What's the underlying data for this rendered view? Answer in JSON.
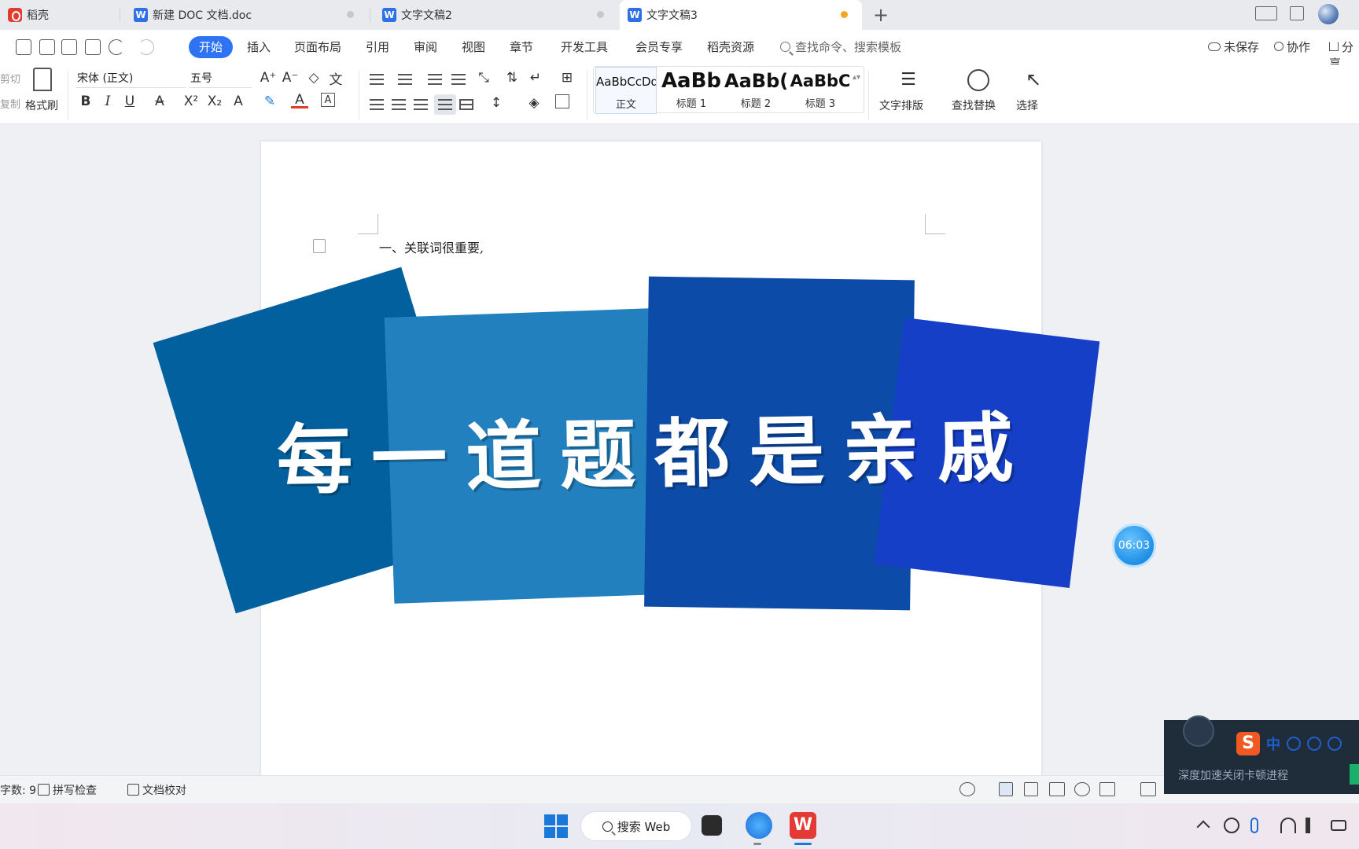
{
  "tabs": [
    {
      "label": "稻壳"
    },
    {
      "label": "新建 DOC 文档.doc"
    },
    {
      "label": "文字文稿2"
    },
    {
      "label": "文字文稿3"
    }
  ],
  "tab_icon_letter": "W",
  "menu": {
    "active": "开始",
    "items": [
      "插入",
      "页面布局",
      "引用",
      "审阅",
      "视图",
      "章节",
      "开发工具",
      "会员专享",
      "稻壳资源"
    ],
    "search_placeholder": "查找命令、搜索模板",
    "unsaved": "未保存",
    "collab": "协作",
    "share": "分享"
  },
  "ribbon": {
    "cut": "剪切",
    "copy": "复制",
    "format_painter": "格式刷",
    "font_name": "宋体 (正文)",
    "font_size": "五号",
    "styles": [
      {
        "sample": "AaBbCcDd",
        "name": "正文"
      },
      {
        "sample": "AaBb",
        "name": "标题 1"
      },
      {
        "sample": "AaBb(",
        "name": "标题 2"
      },
      {
        "sample": "AaBbC",
        "name": "标题 3"
      }
    ],
    "text_layout": "文字排版",
    "find_replace": "查找替换",
    "select": "选择"
  },
  "document": {
    "line1": "一、关联词很重要,",
    "headline": "每一道题都是亲戚"
  },
  "timer": "06:03",
  "status": {
    "word_count": "字数: 9",
    "spell_check": "拼写检查",
    "proofread": "文档校对"
  },
  "popup": {
    "ime_logo": "S",
    "ime_mode": "中",
    "message": "深度加速关闭卡顿进程"
  },
  "taskbar": {
    "search": "搜索 Web"
  },
  "colors": {
    "accent": "#2f73f5",
    "card1": "#03609f",
    "card2": "#2280bf",
    "card3": "#0c4ba8",
    "card4": "#153fc7"
  }
}
